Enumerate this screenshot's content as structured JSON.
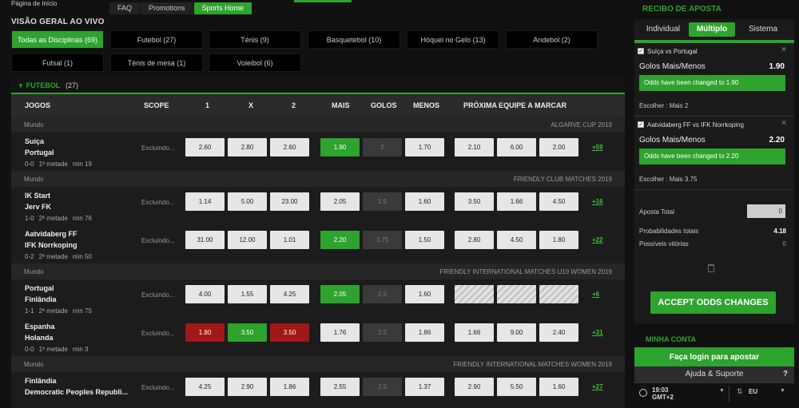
{
  "topnav": {
    "home": "Página de Início",
    "tabs": [
      {
        "label": "FAQ"
      },
      {
        "label": "Promotions"
      },
      {
        "label": "Sports Home"
      }
    ]
  },
  "overview_title": "VISÃO GERAL AO VIVO",
  "filters": [
    {
      "label": "Todas as Disciplinas (69)"
    },
    {
      "label": "Futebol (27)"
    },
    {
      "label": "Ténis (9)"
    },
    {
      "label": "Basquetebol (10)"
    },
    {
      "label": "Hóquei no Gelo (13)"
    },
    {
      "label": "Andebol (2)"
    },
    {
      "label": "Futsal (1)"
    },
    {
      "label": "Ténis de mesa (1)"
    },
    {
      "label": "Voleibol (6)"
    }
  ],
  "category": {
    "name": "FUTEBOL",
    "count": "(27)"
  },
  "columns": {
    "games": "JOGOS",
    "scope": "SCOPE",
    "c1": "1",
    "cx": "X",
    "c2": "2",
    "mais": "MAIS",
    "golos": "GOLOS",
    "menos": "MENOS",
    "next": "PRÓXIMA EQUIPE A MARCAR"
  },
  "leagues": [
    {
      "region": "Mundo",
      "name": "ALGARVE CUP 2019"
    },
    {
      "region": "Mundo",
      "name": "FRIENDLY CLUB MATCHES 2019"
    },
    {
      "region": "Mundo",
      "name": "FRIENDLY INTERNATIONAL MATCHES U19 WOMEN 2019"
    },
    {
      "region": "Mundo",
      "name": "FRIENDLY INTERNATIONAL MATCHES WOMEN 2019"
    }
  ],
  "matches": [
    {
      "home": "Suíça",
      "away": "Portugal",
      "score": "0-0",
      "period": "1ª metade",
      "minute": "min 19",
      "scope": "Excluindo...",
      "o1": "2.60",
      "ox": "2.80",
      "o2": "2.60",
      "mais": "1.90",
      "golos": "2",
      "menos": "1.70",
      "n1": "2.10",
      "nx": "6.00",
      "n2": "2.00",
      "more": "+59"
    },
    {
      "home": "IK Start",
      "away": "Jerv FK",
      "score": "1-0",
      "period": "2ª metade",
      "minute": "min 76",
      "scope": "Excluindo...",
      "o1": "1.14",
      "ox": "5.00",
      "o2": "23.00",
      "mais": "2.05",
      "golos": "1.5",
      "menos": "1.60",
      "n1": "3.50",
      "nx": "1.66",
      "n2": "4.50",
      "more": "+16"
    },
    {
      "home": "Aatvidaberg FF",
      "away": "IFK Norrkoping",
      "score": "0-2",
      "period": "2ª metade",
      "minute": "min 50",
      "scope": "Excluindo...",
      "o1": "31.00",
      "ox": "12.00",
      "o2": "1.01",
      "mais": "2.20",
      "golos": "3.75",
      "menos": "1.50",
      "n1": "2.80",
      "nx": "4.50",
      "n2": "1.80",
      "more": "+22"
    },
    {
      "home": "Portugal",
      "away": "Finlândia",
      "score": "1-1",
      "period": "2ª metade",
      "minute": "min 75",
      "scope": "Excluindo...",
      "o1": "4.00",
      "ox": "1.55",
      "o2": "4.25",
      "mais": "2.05",
      "golos": "2.5",
      "menos": "1.60",
      "n1": "",
      "nx": "",
      "n2": "",
      "more": "+6"
    },
    {
      "home": "Espanha",
      "away": "Holanda",
      "score": "0-0",
      "period": "1ª metade",
      "minute": "min 3",
      "scope": "Excluindo...",
      "o1": "1.80",
      "ox": "3.50",
      "o2": "3.50",
      "mais": "1.76",
      "golos": "2.5",
      "menos": "1.86",
      "n1": "1.66",
      "nx": "9.00",
      "n2": "2.40",
      "more": "+31"
    },
    {
      "home": "Finlândia",
      "away": "Democratic Peoples Republi...",
      "score": "",
      "period": "",
      "minute": "",
      "scope": "Excluindo...",
      "o1": "4.25",
      "ox": "2.90",
      "o2": "1.86",
      "mais": "2.55",
      "golos": "2.5",
      "menos": "1.37",
      "n1": "2.90",
      "nx": "5.50",
      "n2": "1.60",
      "more": "+27"
    }
  ],
  "slip": {
    "title": "RECIBO DE APOSTA",
    "tabs": [
      "Individual",
      "Múltiplo",
      "Sistema"
    ],
    "bets": [
      {
        "event": "Suíça vs Portugal",
        "market": "Golos Mais/Menos",
        "price": "1.90",
        "warning": "Odds have been changed to 1.90",
        "pick": "Escolher : Mais 2",
        "close": "×"
      },
      {
        "event": "Aatvidaberg FF vs IFK Norrkoping",
        "market": "Golos Mais/Menos",
        "price": "2.20",
        "warning": "Odds have been changed to 2.20",
        "pick": "Escolher : Mais 3.75",
        "close": "×"
      }
    ],
    "stake_label": "Aposta Total",
    "stake_value": "0",
    "total_odds_label": "Probabilidades totais",
    "total_odds": "4.18",
    "wins_label": "Possíveis vitórias",
    "wins": "0",
    "accept": "ACCEPT ODDS CHANGES"
  },
  "account": {
    "title": "MINHA CONTA",
    "login": "Faça login para apostar",
    "help": "Ajuda & Suporte",
    "help_q": "?",
    "time": "19:03",
    "tz": "GMT+2",
    "format": "EU"
  },
  "colors": {
    "accent": "#2ea32e",
    "red": "#a01818"
  }
}
